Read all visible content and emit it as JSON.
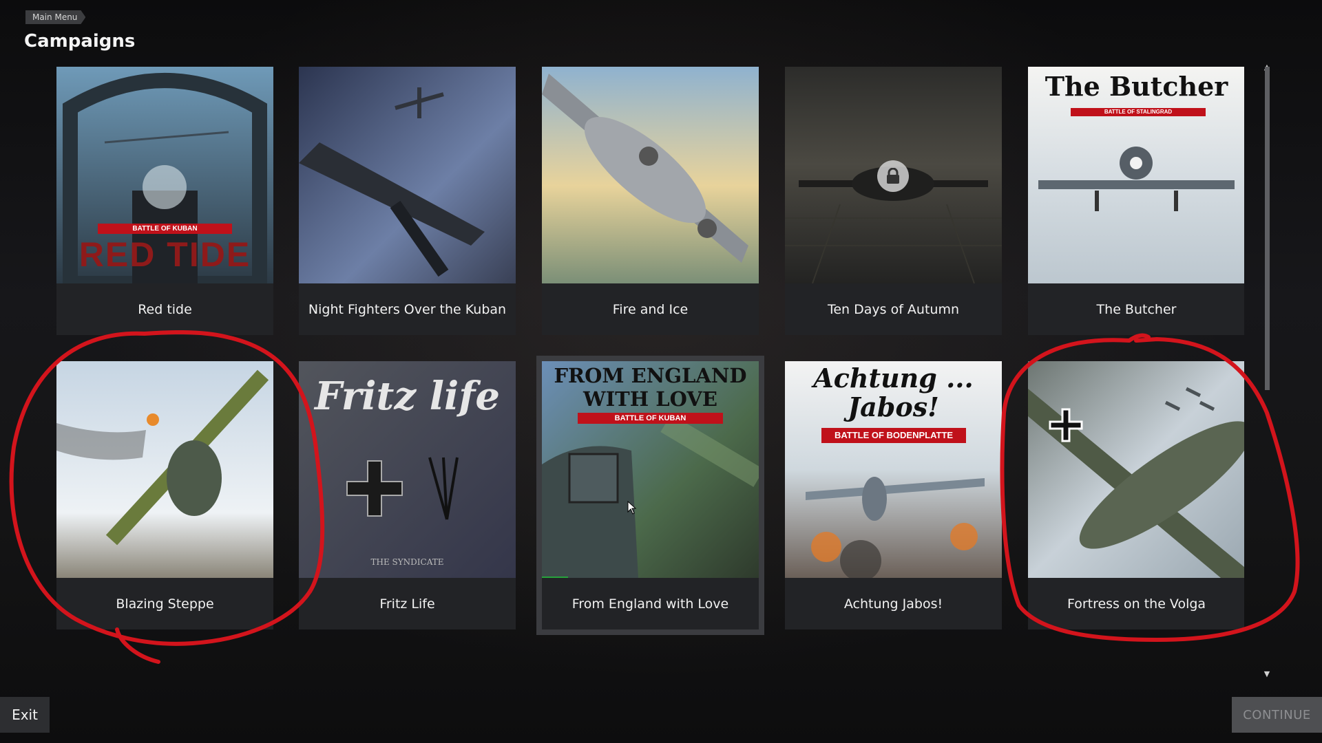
{
  "breadcrumb": {
    "label": "Main Menu"
  },
  "page": {
    "title": "Campaigns"
  },
  "campaigns": [
    {
      "title": "Red tide",
      "art_banner": "BATTLE OF KUBAN",
      "art_title": "RED TIDE"
    },
    {
      "title": "Night Fighters Over the Kuban"
    },
    {
      "title": "Fire and Ice"
    },
    {
      "title": "Ten Days of Autumn",
      "locked": true,
      "lock_icon": "lock-icon"
    },
    {
      "title": "The Butcher",
      "art_title": "The Butcher",
      "art_banner": "BATTLE OF STALINGRAD"
    },
    {
      "title": "Blazing Steppe",
      "annotated": true
    },
    {
      "title": "Fritz Life",
      "art_title": "Fritz life",
      "art_credit": "THE SYNDICATE"
    },
    {
      "title": "From England with Love",
      "art_title_line1": "FROM ENGLAND",
      "art_title_line2": "WITH LOVE",
      "art_banner": "BATTLE OF KUBAN",
      "selected": true,
      "progress": 0.12
    },
    {
      "title": "Achtung Jabos!",
      "art_title_line1": "Achtung ...",
      "art_title_line2": "Jabos!",
      "art_banner": "BATTLE OF BODENPLATTE"
    },
    {
      "title": "Fortress on the Volga",
      "annotated": true
    }
  ],
  "footer": {
    "exit_label": "Exit",
    "continue_label": "CONTINUE"
  },
  "colors": {
    "annotation": "#d3141c",
    "banner": "#c0111a",
    "progress": "#27a33b"
  }
}
